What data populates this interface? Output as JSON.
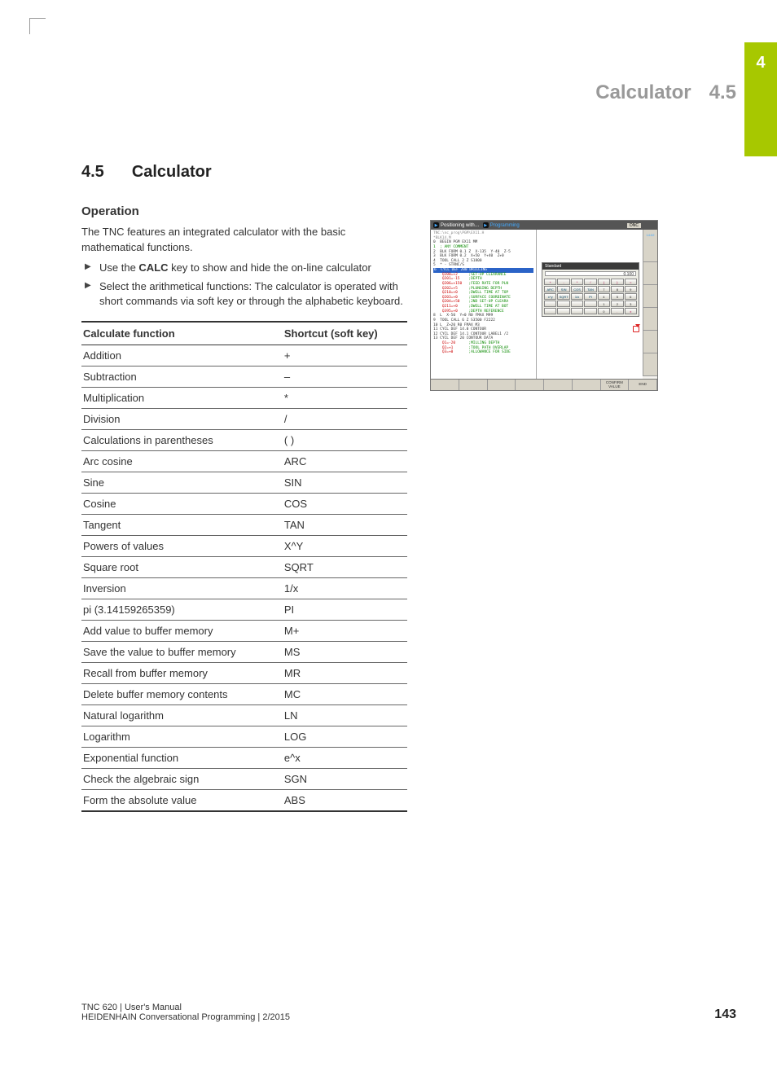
{
  "chapter_tab": "4",
  "header": {
    "title": "Calculator",
    "section": "4.5"
  },
  "section_heading": {
    "num": "4.5",
    "title": "Calculator"
  },
  "subheading": "Operation",
  "intro": "The TNC features an integrated calculator with the basic mathematical functions.",
  "bullets": {
    "b1_pre": "Use the ",
    "b1_bold": "CALC",
    "b1_post": " key to show and hide the on-line calculator",
    "b2": "Select the arithmetical functions: The calculator is operated with short commands via soft key or through the alphabetic keyboard."
  },
  "table": {
    "head": {
      "c1": "Calculate function",
      "c2": "Shortcut (soft key)"
    },
    "rows": [
      {
        "c1": "Addition",
        "c2": "+"
      },
      {
        "c1": "Subtraction",
        "c2": "–"
      },
      {
        "c1": "Multiplication",
        "c2": "*"
      },
      {
        "c1": "Division",
        "c2": "/"
      },
      {
        "c1": "Calculations in parentheses",
        "c2": "( )"
      },
      {
        "c1": "Arc cosine",
        "c2": "ARC"
      },
      {
        "c1": "Sine",
        "c2": "SIN"
      },
      {
        "c1": "Cosine",
        "c2": "COS"
      },
      {
        "c1": "Tangent",
        "c2": "TAN"
      },
      {
        "c1": "Powers of values",
        "c2": "X^Y"
      },
      {
        "c1": "Square root",
        "c2": "SQRT"
      },
      {
        "c1": "Inversion",
        "c2": "1/x"
      },
      {
        "c1": "pi (3.14159265359)",
        "c2": "PI"
      },
      {
        "c1": "Add value to buffer memory",
        "c2": "M+"
      },
      {
        "c1": "Save the value to buffer memory",
        "c2": "MS"
      },
      {
        "c1": "Recall from buffer memory",
        "c2": "MR"
      },
      {
        "c1": "Delete buffer memory contents",
        "c2": "MC"
      },
      {
        "c1": "Natural logarithm",
        "c2": "LN"
      },
      {
        "c1": "Logarithm",
        "c2": "LOG"
      },
      {
        "c1": "Exponential function",
        "c2": "e^x"
      },
      {
        "c1": "Check the algebraic sign",
        "c2": "SGN"
      },
      {
        "c1": "Form the absolute value",
        "c2": "ABS"
      }
    ]
  },
  "screenshot": {
    "mode1": "Positioning with…",
    "mode2": "Programming",
    "dnc": "DNC",
    "side_hint": "14:02",
    "title_line": "TNC:\\nc_prog\\PGM\\EX11.H",
    "block_line": "*BLK14.M",
    "code": [
      "0  BEGIN PGM EX11 MM",
      "1  ; ANY COMMENT",
      "2  BLK FORM 0.1 Z  X-135  Y-40  Z-5",
      "3  BLK FORM 0.2  X+50  Y+40  Z+0",
      "4  TOOL CALL 2 Z S1800",
      "5  * - STRNC/S",
      "6  CYCL DEF 200 DRILLING",
      "    Q200=+2     ;SET-UP CLEARANCE",
      "    Q201=-15    ;DEPTH",
      "    Q206=+150   ;FEED RATE FOR PLN",
      "    Q202=+5     ;PLUNGING DEPTH",
      "    Q210=+0     ;DWELL TIME AT TOP",
      "    Q203=+0     ;SURFACE COORDINATE",
      "    Q204=+50    ;2ND SET-UP CLEARA",
      "    Q211=+0     ;DWELL TIME AT BOT",
      "    Q395=+0     ;DEPTH REFERENCE",
      "8  L  X-50  Y+0 R0 FMAX M99",
      "9  TOOL CALL 6 Z S3500 F2222",
      "10 L  Z+20 R0 FMAX M3",
      "11 CYCL DEF 14.0 CONTOUR",
      "12 CYCL DEF 14.1 CONTOUR LABEL1 /2",
      "13 CYCL DEF 20 CONTOUR DATA",
      "    Q1=-20      ;MILLING DEPTH",
      "    Q2=+1       ;TOOL PATH OVERLAP",
      "    Q3=+0       ;ALLOWANCE FOR SIDE"
    ],
    "highlight_line": "6  CYCL DEF 200 DRILLING",
    "calc": {
      "title": "Standard",
      "display": "0.100",
      "rows": [
        [
          "+",
          "-",
          "*",
          "/",
          "(",
          ")",
          "="
        ],
        [
          "ARC",
          "SIN",
          "COS",
          "TAN",
          "7",
          "8",
          "9"
        ],
        [
          "x^y",
          "SQRT",
          "1/x",
          "PI",
          "4",
          "5",
          "6"
        ],
        [
          "",
          "",
          "",
          "",
          "1",
          "2",
          "3"
        ],
        [
          "",
          "",
          "",
          "",
          "0",
          ".",
          "±"
        ]
      ]
    },
    "softkeys": [
      "",
      "",
      "",
      "",
      "",
      "",
      "CONFIRM\nVALUE",
      "END"
    ]
  },
  "footer": {
    "line1": "TNC 620 | User's Manual",
    "line2": "HEIDENHAIN Conversational Programming | 2/2015",
    "page": "143"
  }
}
